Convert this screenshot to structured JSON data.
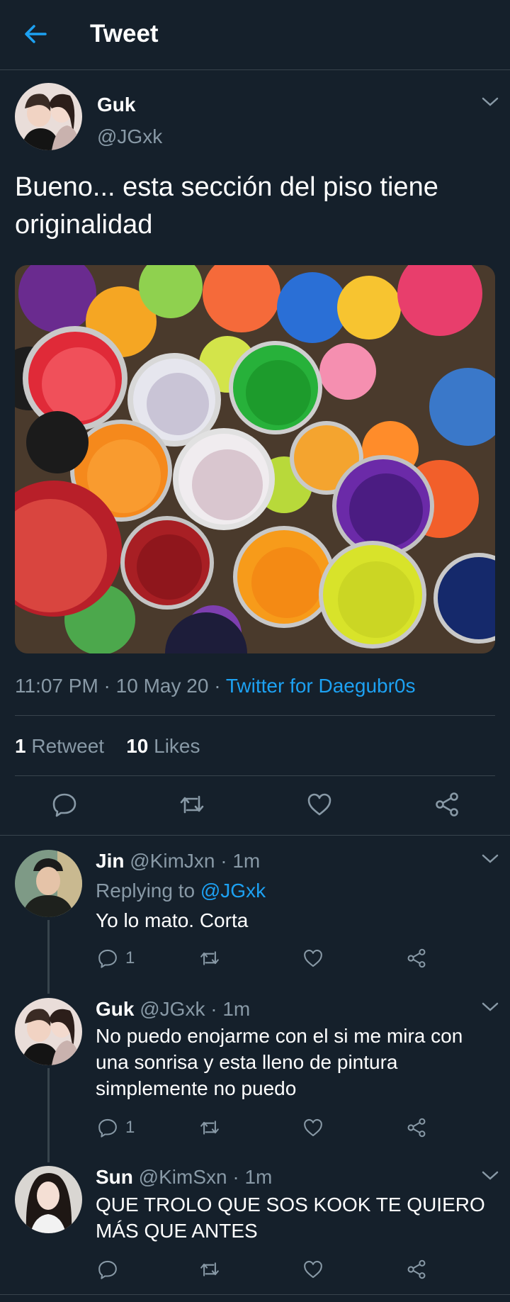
{
  "header": {
    "title": "Tweet"
  },
  "tweet": {
    "name": "Guk",
    "handle": "@JGxk",
    "text": "Bueno... esta sección del piso tiene originalidad",
    "time": "11:07 PM",
    "date": "10 May 20",
    "source": "Twitter for Daegubr0s",
    "retweets": "1",
    "retweets_label": "Retweet",
    "likes": "10",
    "likes_label": "Likes"
  },
  "replies": [
    {
      "name": "Jin",
      "handle": "@KimJxn",
      "time": "1m",
      "replying_prefix": "Replying to",
      "replying_to": "@JGxk",
      "text": "Yo lo mato. Corta",
      "reply_count": "1"
    },
    {
      "name": "Guk",
      "handle": "@JGxk",
      "time": "1m",
      "text": "No puedo enojarme con el si me mira con una sonrisa y esta lleno de pintura simplemente no puedo",
      "reply_count": "1"
    },
    {
      "name": "Sun",
      "handle": "@KimSxn",
      "time": "1m",
      "text": "QUE TROLO QUE SOS KOOK TE QUIERO MÁS QUE ANTES",
      "reply_count": ""
    }
  ],
  "colors": {
    "background": "#15202b",
    "accent": "#1da1f2",
    "muted": "#8899a6",
    "divider": "#38444d"
  }
}
